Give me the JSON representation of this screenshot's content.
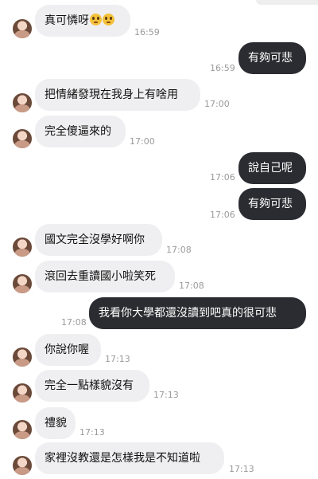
{
  "chat": {
    "messages": [
      {
        "side": "in",
        "text": "真可憐呀",
        "emoji": "pleading-face-icon pleading-face-icon",
        "time": "16:59"
      },
      {
        "side": "out",
        "text": "有夠可悲",
        "time": "16:59"
      },
      {
        "side": "in",
        "text": "把情緒發現在我身上有啥用",
        "time": "17:00"
      },
      {
        "side": "in",
        "text": "完全傻逼來的",
        "time": "17:00"
      },
      {
        "side": "out",
        "text": "說自己呢",
        "time": "17:06"
      },
      {
        "side": "out",
        "text": "有夠可悲",
        "time": "17:06"
      },
      {
        "side": "in",
        "text": "國文完全沒學好啊你",
        "time": "17:08"
      },
      {
        "side": "in",
        "text": "滾回去重讀國小啦笑死",
        "time": "17:08"
      },
      {
        "side": "out",
        "text": "我看你大學都還沒讀到吧真的很可悲",
        "time": "17:08"
      },
      {
        "side": "in",
        "text": "你說你喔",
        "time": "17:13"
      },
      {
        "side": "in",
        "text": "完全一點樣貌沒有",
        "time": "17:13"
      },
      {
        "side": "in",
        "text": "禮貌",
        "time": "17:13"
      },
      {
        "side": "in",
        "text": "家裡沒教還是怎樣我是不知道啦",
        "time": "17:13"
      }
    ]
  }
}
